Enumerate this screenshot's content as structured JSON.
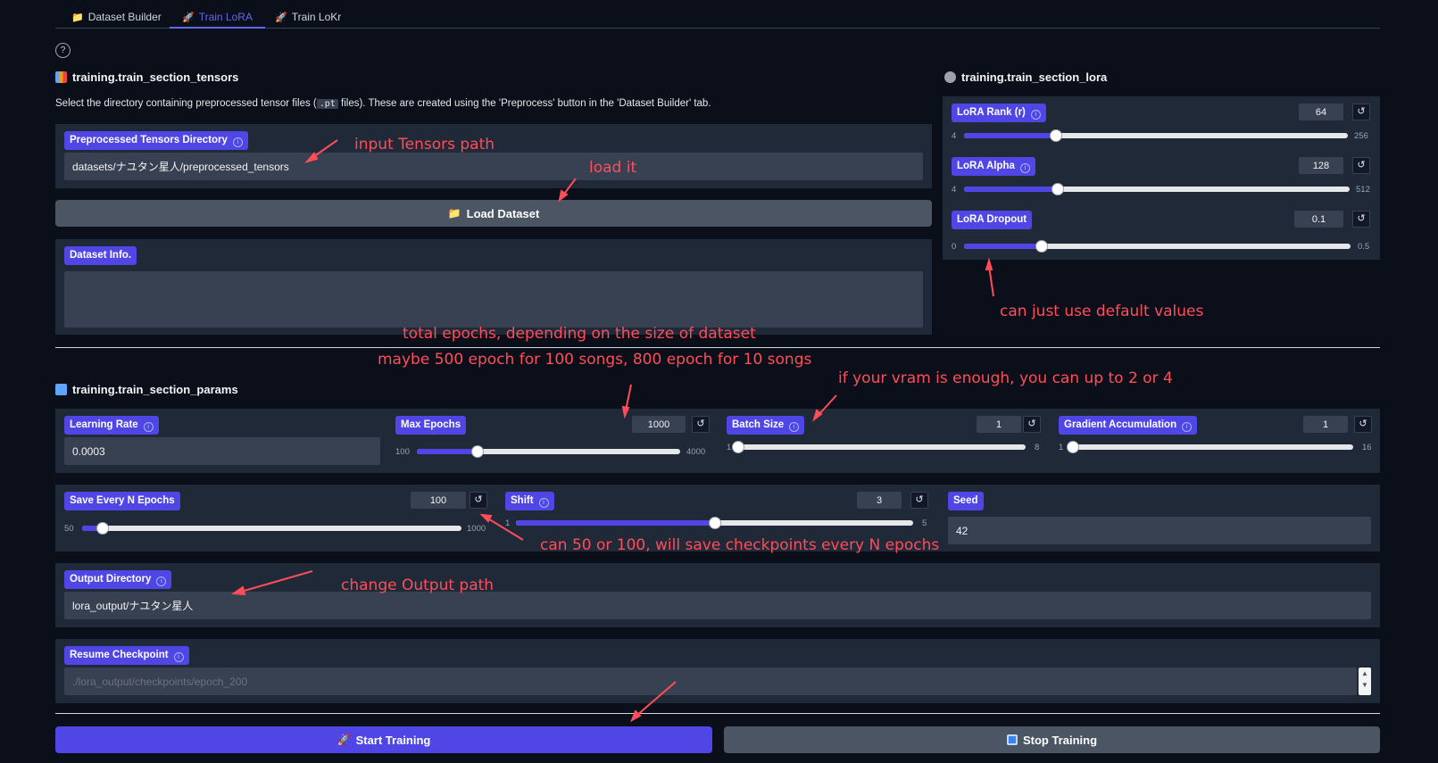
{
  "tabs": [
    {
      "icon": "📁",
      "label": "Dataset Builder",
      "active": false
    },
    {
      "icon": "🚀",
      "label": "Train LoRA",
      "active": true
    },
    {
      "icon": "🚀",
      "label": "Train LoKr",
      "active": false
    }
  ],
  "help_label": "?",
  "tensors": {
    "title": "training.train_section_tensors",
    "desc_before": "Select the directory containing preprocessed tensor files (",
    "desc_code": ".pt",
    "desc_after": " files). These are created using the 'Preprocess' button in the 'Dataset Builder' tab.",
    "dir_label": "Preprocessed Tensors Directory",
    "dir_value": "datasets/ナユタン星人/preprocessed_tensors",
    "load_button": "Load Dataset",
    "info_label": "Dataset Info.",
    "info_value": ""
  },
  "lora": {
    "title": "training.train_section_lora",
    "rank": {
      "label": "LoRA Rank (r)",
      "value": "64",
      "min": "4",
      "max": "256"
    },
    "alpha": {
      "label": "LoRA Alpha",
      "value": "128",
      "min": "4",
      "max": "512"
    },
    "dropout": {
      "label": "LoRA Dropout",
      "value": "0.1",
      "min": "0",
      "max": "0.5"
    }
  },
  "params": {
    "title": "training.train_section_params",
    "learning_rate": {
      "label": "Learning Rate",
      "value": "0.0003"
    },
    "max_epochs": {
      "label": "Max Epochs",
      "value": "1000",
      "min": "100",
      "max": "4000"
    },
    "batch_size": {
      "label": "Batch Size",
      "value": "1",
      "min": "1",
      "max": "8"
    },
    "grad_accum": {
      "label": "Gradient Accumulation",
      "value": "1",
      "min": "1",
      "max": "16"
    },
    "save_every": {
      "label": "Save Every N Epochs",
      "value": "100",
      "min": "50",
      "max": "1000"
    },
    "shift": {
      "label": "Shift",
      "value": "3",
      "min": "1",
      "max": "5"
    },
    "seed": {
      "label": "Seed",
      "value": "42"
    },
    "output_dir": {
      "label": "Output Directory",
      "value": "lora_output/ナユタン星人"
    },
    "resume": {
      "label": "Resume Checkpoint",
      "placeholder": "./lora_output/checkpoints/epoch_200"
    }
  },
  "actions": {
    "start": "Start Training",
    "stop": "Stop Training"
  },
  "reset_glyph": "↺",
  "annotations": {
    "input_tensors": "input Tensors path",
    "load_it": "load it",
    "defaults": "can just use default values",
    "epochs_1": "total epochs, depending on the size of dataset",
    "epochs_2": "maybe 500 epoch for 100 songs, 800 epoch for 10 songs",
    "vram": "if your vram is enough, you can up to 2 or 4",
    "save_every": "can 50 or 100, will save checkpoints every N epochs",
    "output": "change Output path"
  },
  "colors": {
    "accent": "#4f46e5",
    "background": "#0b0f19",
    "panel": "#1f2937",
    "annotation": "#ff4d5a"
  }
}
